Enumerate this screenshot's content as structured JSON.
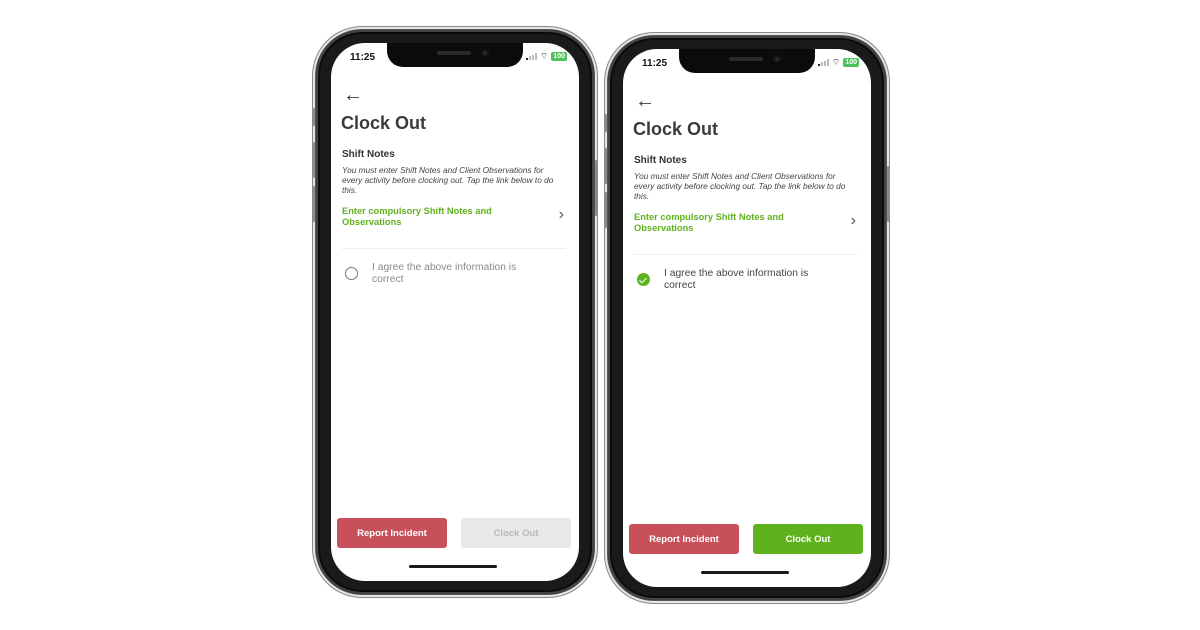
{
  "phones": [
    {
      "status_bar": {
        "time": "11:25",
        "battery": "100",
        "wifi_icon": "wifi-icon",
        "signal_icon": "cellular-signal-icon"
      },
      "back_icon": "arrow-left-icon",
      "title": "Clock Out",
      "section_title": "Shift Notes",
      "section_desc": "You must enter Shift Notes and Client Observations for every activity before clocking out. Tap the link below to do this.",
      "notes_link": "Enter compulsory Shift Notes and Observations",
      "agree_label": "I agree the above information is correct",
      "agree_checked": false,
      "buttons": {
        "report": "Report Incident",
        "clock_out": "Clock Out",
        "clock_out_enabled": false
      }
    },
    {
      "status_bar": {
        "time": "11:25",
        "battery": "100",
        "wifi_icon": "wifi-icon",
        "signal_icon": "cellular-signal-icon"
      },
      "back_icon": "arrow-left-icon",
      "title": "Clock Out",
      "section_title": "Shift Notes",
      "section_desc": "You must enter Shift Notes and Client Observations for every activity before clocking out. Tap the link below to do this.",
      "notes_link": "Enter compulsory Shift Notes and Observations",
      "agree_label": "I agree the above information is correct",
      "agree_checked": true,
      "buttons": {
        "report": "Report Incident",
        "clock_out": "Clock Out",
        "clock_out_enabled": true
      }
    }
  ],
  "colors": {
    "accent_green": "#5fb21e",
    "report_red": "#c8505a",
    "disabled_gray": "#e8e8e8",
    "battery_green": "#4cc35a"
  },
  "icons": {
    "back": "←",
    "chevron": "›",
    "wifi": "⌔"
  }
}
